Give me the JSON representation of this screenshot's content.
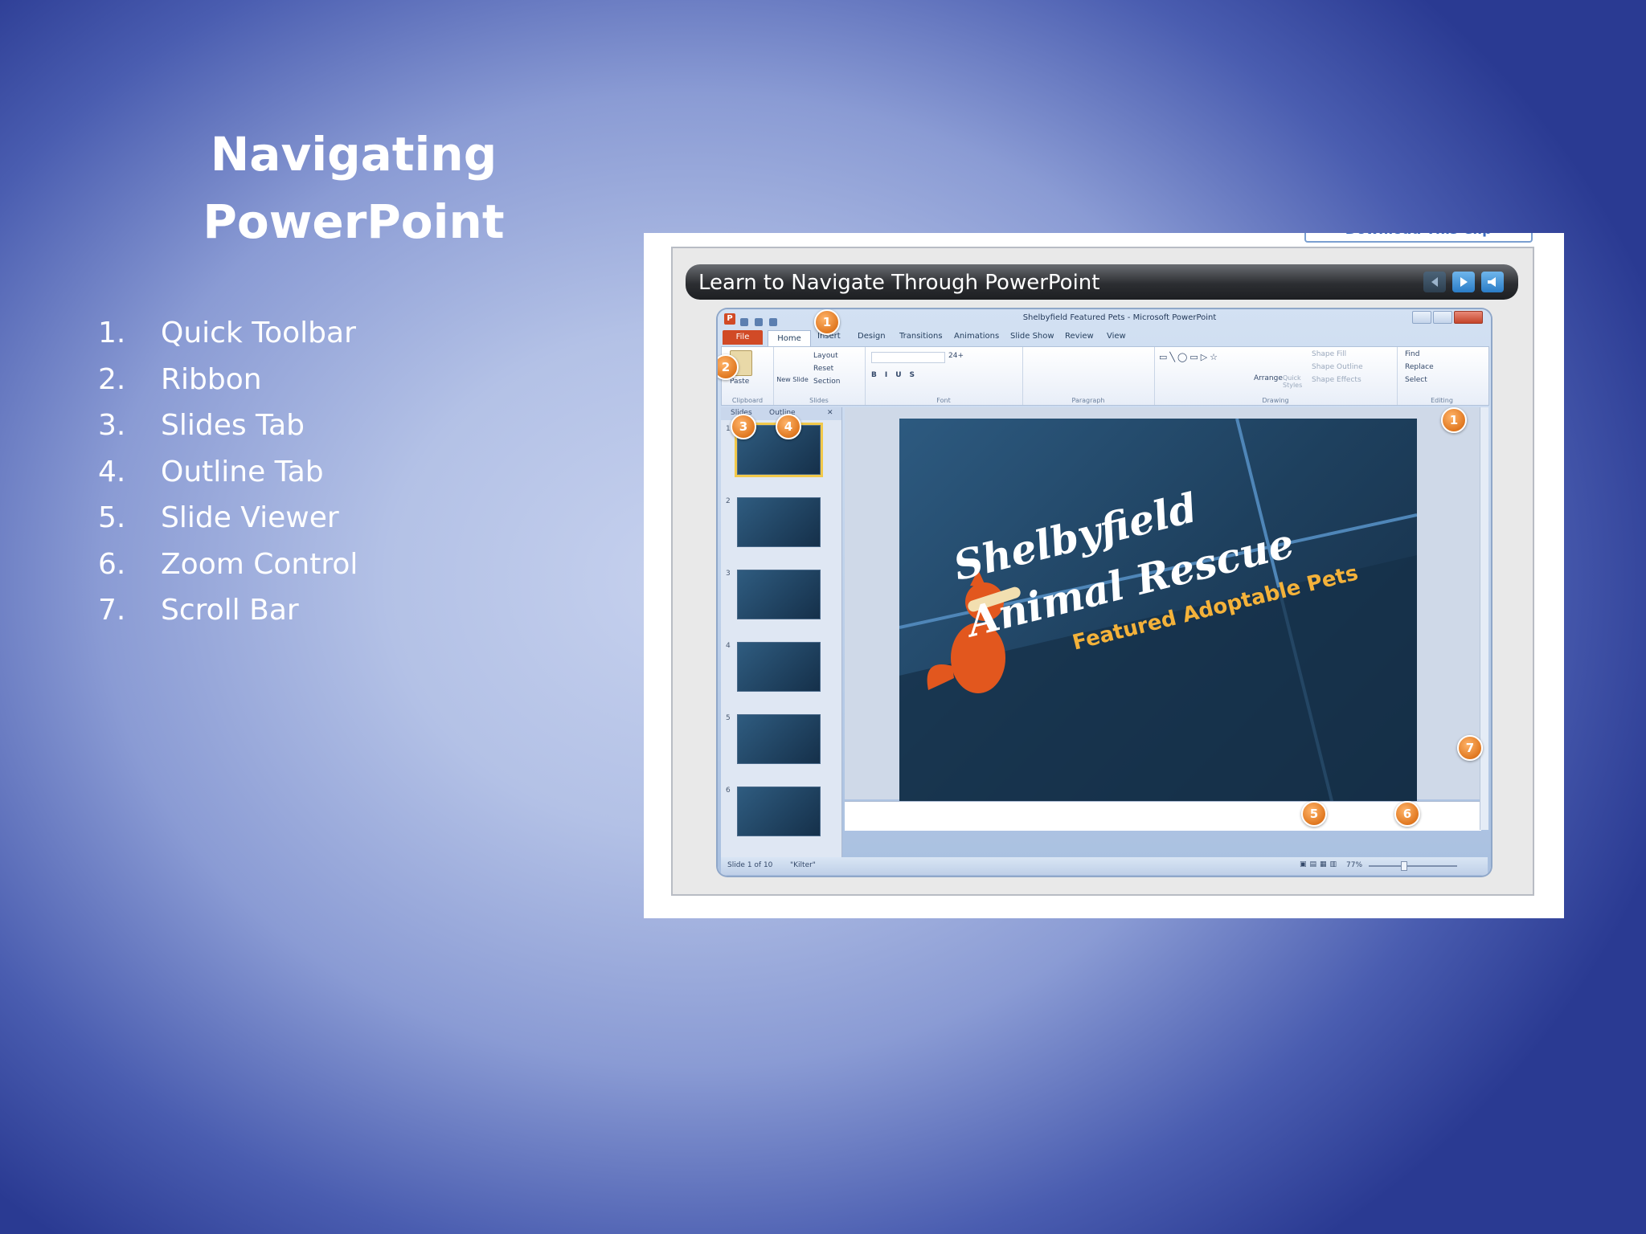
{
  "slide": {
    "title_line1": "Navigating",
    "title_line2": "PowerPoint",
    "items": [
      {
        "num": "1.",
        "label": "Quick Toolbar"
      },
      {
        "num": "2.",
        "label": "Ribbon"
      },
      {
        "num": "3.",
        "label": "Slides Tab"
      },
      {
        "num": "4.",
        "label": "Outline Tab"
      },
      {
        "num": "5.",
        "label": "Slide Viewer"
      },
      {
        "num": "6.",
        "label": "Zoom Control"
      },
      {
        "num": "7.",
        "label": "Scroll Bar"
      }
    ]
  },
  "clip": {
    "download_label": "Download This Clip",
    "player_title": "Learn to Navigate Through PowerPoint",
    "window_title": "Shelbyfield Featured Pets - Microsoft PowerPoint",
    "tabs": [
      "File",
      "Home",
      "Insert",
      "Design",
      "Transitions",
      "Animations",
      "Slide Show",
      "Review",
      "View"
    ],
    "ribbon_groups": {
      "clipboard": "Clipboard",
      "slides": "Slides",
      "font": "Font",
      "paragraph": "Paragraph",
      "drawing": "Drawing",
      "editing": "Editing"
    },
    "ribbon_items": {
      "paste": "Paste",
      "new_slide": "New Slide",
      "layout": "Layout",
      "reset": "Reset",
      "section": "Section",
      "font_size": "24+",
      "arrange": "Arrange",
      "quick_styles": "Quick Styles",
      "shape_fill": "Shape Fill",
      "shape_outline": "Shape Outline",
      "shape_effects": "Shape Effects",
      "find": "Find",
      "replace": "Replace",
      "select": "Select"
    },
    "pane_tabs": {
      "slides": "Slides",
      "outline": "Outline"
    },
    "thumb_numbers": [
      "1",
      "2",
      "3",
      "4",
      "5",
      "6"
    ],
    "slide_title_line1": "Shelbyfield",
    "slide_title_line2": "Animal Rescue",
    "slide_subtitle": "Featured Adoptable Pets",
    "status": {
      "slide_count": "Slide 1 of 10",
      "theme": "\"Kilter\"",
      "zoom": "77%"
    },
    "callouts": [
      "1",
      "2",
      "3",
      "4",
      "1",
      "7",
      "5",
      "6"
    ]
  },
  "colors": {
    "callout": "#e07820",
    "file_tab": "#d14a26",
    "slide_subtitle": "#f4b23a"
  }
}
